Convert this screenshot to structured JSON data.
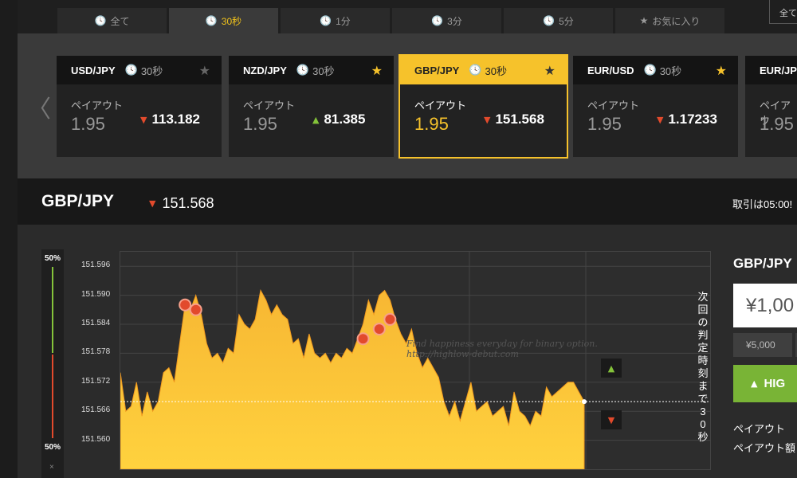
{
  "tabs": [
    {
      "label": "全て",
      "icon": "clock-icon"
    },
    {
      "label": "30秒",
      "icon": "clock-icon",
      "active": true
    },
    {
      "label": "1分",
      "icon": "clock-icon"
    },
    {
      "label": "3分",
      "icon": "clock-icon"
    },
    {
      "label": "5分",
      "icon": "clock-icon"
    },
    {
      "label": "お気に入り",
      "icon": "star-icon"
    }
  ],
  "top_right_label": "全て",
  "cards": [
    {
      "pair": "USD/JPY",
      "period": "30秒",
      "payout_label": "ペイアウト",
      "payout": "1.95",
      "price": "113.182",
      "direction": "down",
      "favorite": false
    },
    {
      "pair": "NZD/JPY",
      "period": "30秒",
      "payout_label": "ペイアウト",
      "payout": "1.95",
      "price": "81.385",
      "direction": "up",
      "favorite": true
    },
    {
      "pair": "GBP/JPY",
      "period": "30秒",
      "payout_label": "ペイアウト",
      "payout": "1.95",
      "price": "151.568",
      "direction": "down",
      "favorite": false,
      "selected": true
    },
    {
      "pair": "EUR/USD",
      "period": "30秒",
      "payout_label": "ペイアウト",
      "payout": "1.95",
      "price": "1.17233",
      "direction": "down",
      "favorite": true
    },
    {
      "pair": "EUR/JPY",
      "period": "",
      "payout_label": "ペイアウ",
      "payout": "1.95",
      "price": "",
      "direction": "",
      "favorite": false
    }
  ],
  "info": {
    "symbol": "GBP/JPY",
    "price": "151.568",
    "deadline": "取引は05:00!"
  },
  "chart_data": {
    "type": "area",
    "ylim": [
      151.554,
      151.599
    ],
    "y_ticks": [
      "151.596",
      "151.590",
      "151.584",
      "151.578",
      "151.572",
      "151.566",
      "151.560"
    ],
    "current_value": 151.568,
    "top_pct": "50%",
    "bottom_pct": "50%",
    "values": [
      151.574,
      151.566,
      151.567,
      151.572,
      151.565,
      151.57,
      151.566,
      151.568,
      151.574,
      151.575,
      151.572,
      151.58,
      151.588,
      151.587,
      151.59,
      151.586,
      151.58,
      151.577,
      151.578,
      151.576,
      151.579,
      151.578,
      151.586,
      151.584,
      151.583,
      151.585,
      151.591,
      151.589,
      151.586,
      151.588,
      151.586,
      151.585,
      151.58,
      151.581,
      151.577,
      151.582,
      151.578,
      151.577,
      151.578,
      151.576,
      151.578,
      151.577,
      151.579,
      151.578,
      151.581,
      151.584,
      151.589,
      151.586,
      151.59,
      151.591,
      151.589,
      151.585,
      151.582,
      151.58,
      151.583,
      151.578,
      151.575,
      151.577,
      151.575,
      151.573,
      151.568,
      151.565,
      151.568,
      151.564,
      151.568,
      151.572,
      151.566,
      151.567,
      151.568,
      151.565,
      151.566,
      151.567,
      151.563,
      151.57,
      151.566,
      151.565,
      151.563,
      151.566,
      151.565,
      151.571,
      151.569,
      151.57,
      151.571,
      151.572,
      151.572,
      151.57,
      151.568
    ]
  },
  "countdown": "次回の判定時刻まで30秒",
  "watermark": [
    "Find happiness everyday for binary option.",
    "http://highlow-debut.com"
  ],
  "panel": {
    "title": "GBP/JPY",
    "amount": "¥1,00",
    "quick_amount": "¥5,000",
    "high_label": "HIG",
    "payout_label": "ペイアウト",
    "payout_amount_label": "ペイアウト額"
  },
  "colors": {
    "accent": "#f6c22b",
    "down": "#e24a2c",
    "up": "#84c33a"
  }
}
